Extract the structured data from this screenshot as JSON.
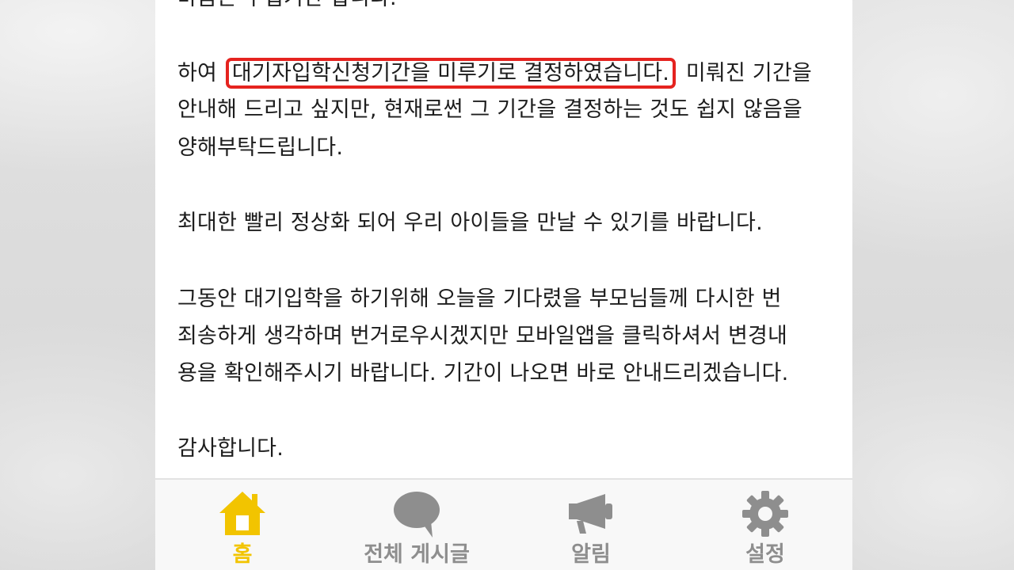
{
  "article": {
    "lines": [
      "마음은 무겁기만 합니다.",
      "하여",
      "대기자입학신청기간을 미루기로 결정하였습니다.",
      "미뤄진 기간을",
      "안내해 드리고 싶지만, 현재로썬 그 기간을 결정하는 것도 쉽지 않음을",
      "양해부탁드립니다.",
      "최대한 빨리 정상화 되어 우리 아이들을 만날 수 있기를 바랍니다.",
      "그동안 대기입학을 하기위해 오늘을 기다렸을 부모님들께 다시한 번",
      "죄송하게 생각하며 번거로우시겠지만 모바일앱을 클릭하셔서 변경내",
      "용을 확인해주시기 바랍니다. 기간이 나오면 바로 안내드리겠습니다.",
      "감사합니다."
    ],
    "highlight_color": "#e5231f"
  },
  "tabbar": {
    "active_color": "#f2c400",
    "inactive_color": "#8e8e8e",
    "tabs": [
      {
        "label": "홈",
        "icon": "home-icon"
      },
      {
        "label": "전체 게시글",
        "icon": "speech-bubble-icon"
      },
      {
        "label": "알림",
        "icon": "megaphone-icon"
      },
      {
        "label": "설정",
        "icon": "gear-icon"
      }
    ]
  }
}
